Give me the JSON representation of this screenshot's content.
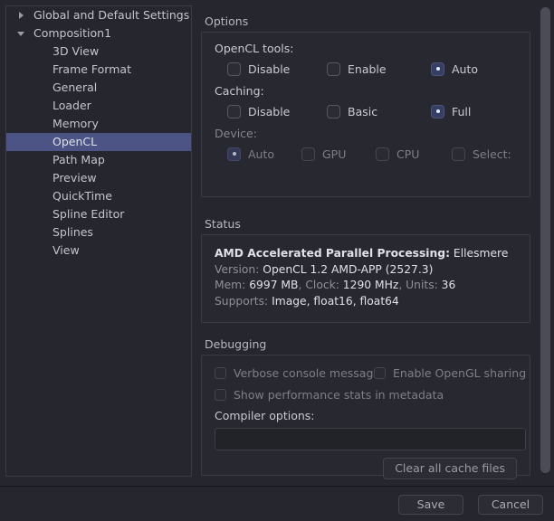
{
  "sidebar": {
    "items": [
      {
        "label": "Global and Default Settings",
        "level": 0,
        "twisty": "collapsed",
        "selected": false
      },
      {
        "label": "Composition1",
        "level": 0,
        "twisty": "expanded",
        "selected": false
      },
      {
        "label": "3D View",
        "level": 1,
        "twisty": "none",
        "selected": false
      },
      {
        "label": "Frame Format",
        "level": 1,
        "twisty": "none",
        "selected": false
      },
      {
        "label": "General",
        "level": 1,
        "twisty": "none",
        "selected": false
      },
      {
        "label": "Loader",
        "level": 1,
        "twisty": "none",
        "selected": false
      },
      {
        "label": "Memory",
        "level": 1,
        "twisty": "none",
        "selected": false
      },
      {
        "label": "OpenCL",
        "level": 1,
        "twisty": "none",
        "selected": true
      },
      {
        "label": "Path Map",
        "level": 1,
        "twisty": "none",
        "selected": false
      },
      {
        "label": "Preview",
        "level": 1,
        "twisty": "none",
        "selected": false
      },
      {
        "label": "QuickTime",
        "level": 1,
        "twisty": "none",
        "selected": false
      },
      {
        "label": "Spline Editor",
        "level": 1,
        "twisty": "none",
        "selected": false
      },
      {
        "label": "Splines",
        "level": 1,
        "twisty": "none",
        "selected": false
      },
      {
        "label": "View",
        "level": 1,
        "twisty": "none",
        "selected": false
      }
    ]
  },
  "options": {
    "group_title": "Options",
    "opencl_tools": {
      "label": "OpenCL tools:",
      "choices": [
        {
          "label": "Disable",
          "checked": false
        },
        {
          "label": "Enable",
          "checked": false
        },
        {
          "label": "Auto",
          "checked": true
        }
      ]
    },
    "caching": {
      "label": "Caching:",
      "choices": [
        {
          "label": "Disable",
          "checked": false
        },
        {
          "label": "Basic",
          "checked": false
        },
        {
          "label": "Full",
          "checked": true
        }
      ]
    },
    "device": {
      "label": "Device:",
      "disabled": true,
      "choices": [
        {
          "label": "Auto",
          "checked": true
        },
        {
          "label": "GPU",
          "checked": false
        },
        {
          "label": "CPU",
          "checked": false
        },
        {
          "label": "Select:",
          "checked": false
        }
      ]
    }
  },
  "status": {
    "group_title": "Status",
    "device_name_label": "AMD Accelerated Parallel Processing:",
    "device_name_value": "Ellesmere",
    "version_label": "Version:",
    "version_value": "OpenCL 1.2 AMD-APP (2527.3)",
    "mem_label": "Mem:",
    "mem_value": "6997 MB",
    "clock_label": "Clock:",
    "clock_value": "1290 MHz",
    "units_label": "Units:",
    "units_value": "36",
    "supports_label": "Supports:",
    "supports_value": "Image, float16, float64"
  },
  "debugging": {
    "group_title": "Debugging",
    "verbose_console": "Verbose console messages",
    "enable_opengl_sharing": "Enable OpenGL sharing",
    "show_perf_stats": "Show performance stats in metadata",
    "compiler_options_label": "Compiler options:",
    "compiler_options_value": "",
    "compiler_options_placeholder": "",
    "clear_cache_label": "Clear all cache files"
  },
  "footer": {
    "save_label": "Save",
    "cancel_label": "Cancel"
  },
  "colors": {
    "background": "#26272e",
    "selection": "#4b5484",
    "panel_border": "#3a3b44",
    "accent_checked": "#373e64",
    "text_primary": "#c9cbd3",
    "text_dim": "#8e9098",
    "text_bright": "#dfe1e8"
  }
}
